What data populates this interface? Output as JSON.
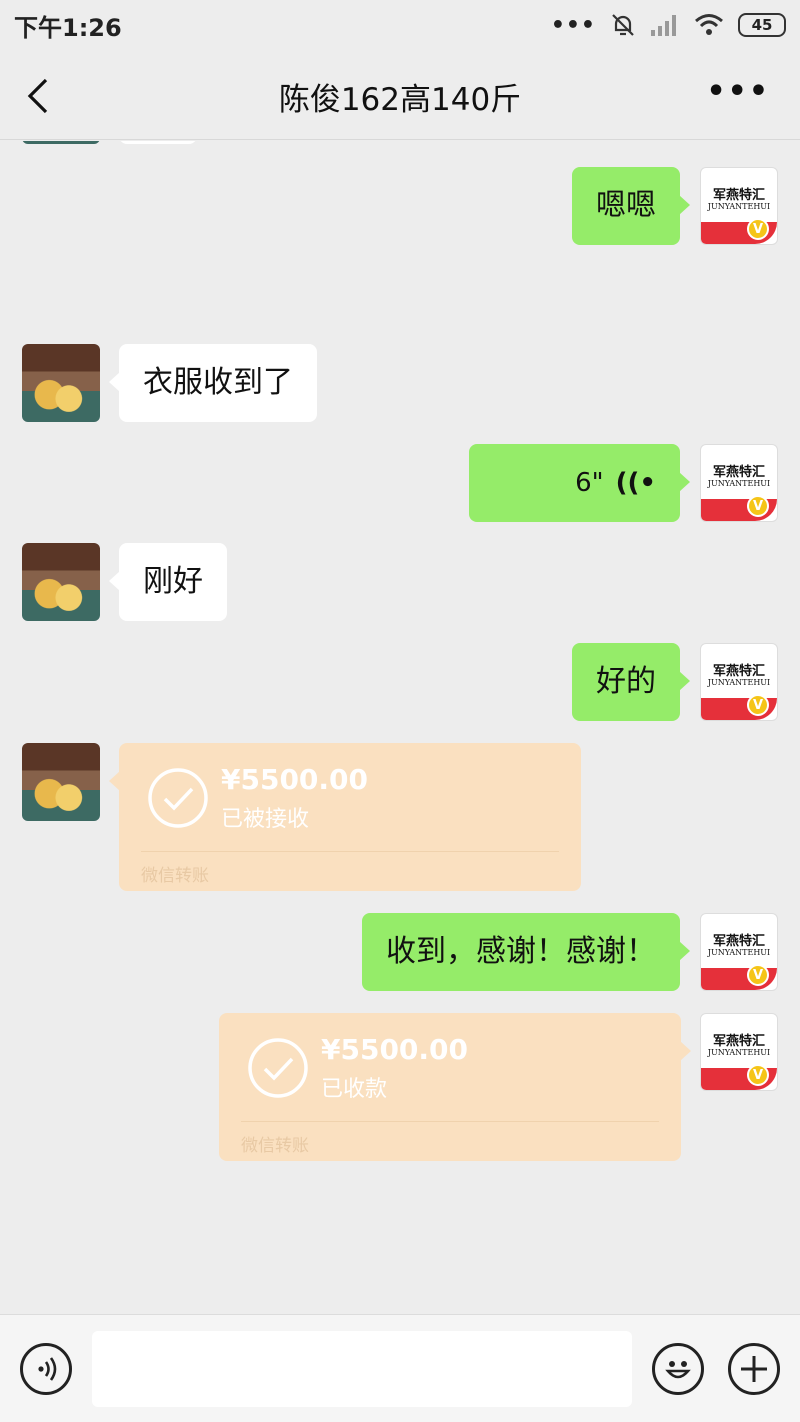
{
  "status_bar": {
    "time": "下午1:26",
    "signal_dots": "•••",
    "battery": "45"
  },
  "header": {
    "title": "陈俊162高140斤",
    "back_icon": "chevron-left-icon",
    "more_label": "•••"
  },
  "brand_avatar": {
    "line1": "军燕特汇",
    "line2": "JUNYANTEHUI",
    "badge": "V"
  },
  "messages": [
    {
      "side": "right",
      "type": "text",
      "text": "嗯嗯"
    },
    {
      "side": "left",
      "type": "text",
      "text": "衣服收到了"
    },
    {
      "side": "right",
      "type": "voice",
      "duration": "6\"",
      "icon": "voice-wave-icon"
    },
    {
      "side": "left",
      "type": "text",
      "text": "刚好"
    },
    {
      "side": "right",
      "type": "text",
      "text": "好的"
    },
    {
      "side": "left",
      "type": "transfer",
      "amount": "¥5500.00",
      "status": "已被接收",
      "label": "微信转账"
    },
    {
      "side": "right",
      "type": "text",
      "text": "收到，感谢！感谢！"
    },
    {
      "side": "right",
      "type": "transfer",
      "amount": "¥5500.00",
      "status": "已收款",
      "label": "微信转账"
    }
  ],
  "bottom_bar": {
    "voice_icon": "voice-input-icon",
    "emoji_icon": "emoji-icon",
    "plus_icon": "plus-icon"
  },
  "colors": {
    "background": "#ededed",
    "bubble_self": "#95ec69",
    "bubble_other": "#ffffff",
    "transfer": "#fae0c0"
  }
}
